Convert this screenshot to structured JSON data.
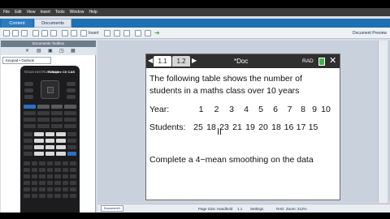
{
  "menubar": [
    "File",
    "Edit",
    "View",
    "Insert",
    "Tools",
    "Window",
    "Help"
  ],
  "tabs": {
    "content": "Content",
    "documents": "Documents"
  },
  "toolbar": {
    "insert_label": "Insert",
    "document_preview": "Document Preview"
  },
  "left_panel": {
    "title": "Documents Toolbox",
    "keypad_select": "Keypad • Outlook"
  },
  "calculator": {
    "brand": "TI-Nspire CX CAS",
    "model": "TEXAS INSTRUMENTS"
  },
  "doc": {
    "tab_active": "1.1",
    "tab_other": "1.2",
    "title": "*Doc",
    "mode": "RAD",
    "text_line1": "The following table shows the number of",
    "text_line2": "students in a maths class over 10 years",
    "year_label": "Year:",
    "years": [
      "1",
      "2",
      "3",
      "4",
      "5",
      "6",
      "7",
      "8",
      "9",
      "10"
    ],
    "students_label": "Students:",
    "students": [
      "25",
      "18",
      "23",
      "21",
      "19",
      "20",
      "18",
      "16",
      "17",
      "15"
    ],
    "instruction": "Complete a 4−mean smoothing on the data"
  },
  "statusbar": {
    "doc_name": "Document1",
    "page_size": "Page Size: Handheld",
    "page_index": "1.1",
    "settings": "Settings",
    "mode": "RAD",
    "zoom": "Zoom: 212%"
  }
}
